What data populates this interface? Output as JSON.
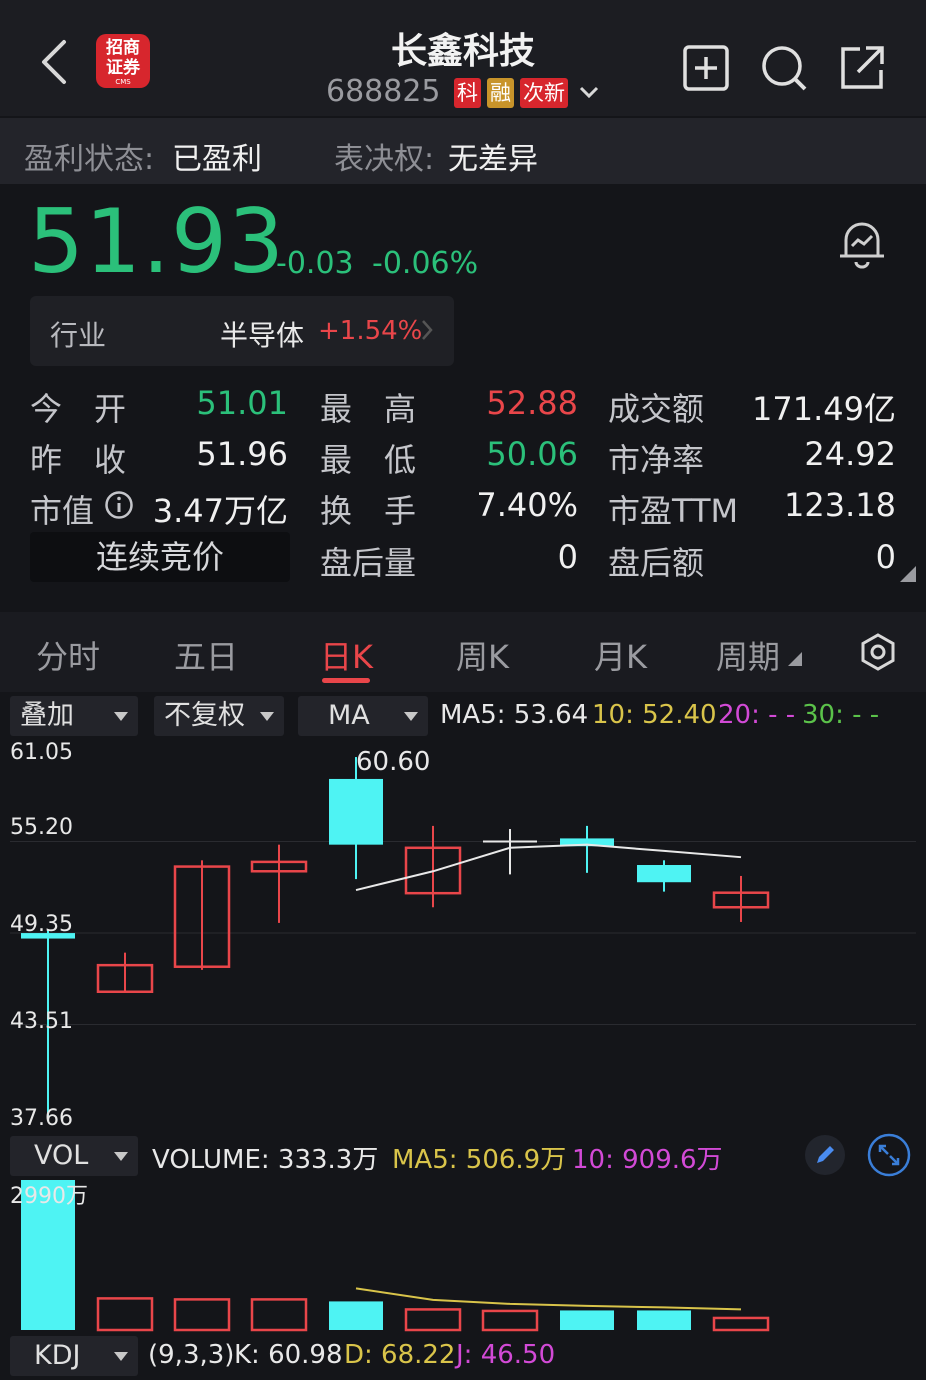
{
  "header": {
    "title": "长鑫科技",
    "code": "688825",
    "tags": [
      {
        "label": "科",
        "color": "#d7262d"
      },
      {
        "label": "融",
        "color": "#c8942a"
      },
      {
        "label": "次新",
        "color": "#d7262d"
      }
    ],
    "logo_line1": "招商",
    "logo_line2": "证券",
    "logo_small": "CMS",
    "icons": [
      "back-icon",
      "add-watchlist-icon",
      "search-icon",
      "share-icon"
    ]
  },
  "status": {
    "profit_label": "盈利状态:",
    "profit_value": "已盈利",
    "vote_label": "表决权:",
    "vote_value": "无差异"
  },
  "quote": {
    "price": "51.93",
    "change": "-0.03",
    "change_pct": "-0.06%",
    "industry_label": "行业",
    "industry_name": "半导体",
    "industry_change": "+1.54%",
    "rows": [
      [
        "今　开",
        "51.01",
        "最　高",
        "52.88",
        "成交额",
        "171.49亿"
      ],
      [
        "昨　收",
        "51.96",
        "最　低",
        "50.06",
        "市净率",
        "24.92"
      ],
      [
        "市值",
        "3.47万亿",
        "换　手",
        "7.40%",
        "市盈TTM",
        "123.18"
      ],
      [
        "",
        "",
        "盘后量",
        "0",
        "盘后额",
        "0"
      ]
    ],
    "auction_label": "连续竞价",
    "colors": {
      "up": "#e9464a",
      "down": "#2bc07a"
    }
  },
  "tabs": {
    "items": [
      "分时",
      "五日",
      "日K",
      "周K",
      "月K",
      "周期"
    ],
    "active": "日K"
  },
  "kline": {
    "overlay_select": "叠加",
    "adjust_select": "不复权",
    "indicator_select": "MA",
    "ma5": "MA5: 53.64",
    "ma10": "10: 52.40",
    "ma20": "20: - -",
    "ma30": "30: - -"
  },
  "vol": {
    "select": "VOL",
    "volume": "VOLUME: 333.3万",
    "ma5": "MA5: 506.9万",
    "ma10": "10: 909.6万",
    "axis_max": "2990万"
  },
  "kdj": {
    "select": "KDJ",
    "params": "(9,3,3)",
    "k": "K: 60.98",
    "d": "D: 68.22",
    "j": "J: 46.50"
  },
  "chart_data": {
    "type": "candlestick",
    "y_ticks": [
      "61.05",
      "55.20",
      "49.35",
      "43.51",
      "37.66"
    ],
    "ylim": [
      37.66,
      61.05
    ],
    "max_label": "60.60",
    "candles": [
      {
        "o": 49.35,
        "h": 49.6,
        "l": 37.66,
        "c": 49.0,
        "dir": "down"
      },
      {
        "o": 45.6,
        "h": 48.1,
        "l": 45.6,
        "c": 47.3,
        "dir": "up"
      },
      {
        "o": 47.2,
        "h": 54.0,
        "l": 47.0,
        "c": 53.6,
        "dir": "up"
      },
      {
        "o": 53.3,
        "h": 55.0,
        "l": 50.0,
        "c": 53.9,
        "dir": "up"
      },
      {
        "o": 59.2,
        "h": 60.6,
        "l": 52.8,
        "c": 55.0,
        "dir": "down"
      },
      {
        "o": 51.9,
        "h": 56.2,
        "l": 51.0,
        "c": 54.8,
        "dir": "up"
      },
      {
        "o": 55.2,
        "h": 56.0,
        "l": 53.1,
        "c": 55.2,
        "dir": "doji"
      },
      {
        "o": 55.4,
        "h": 56.2,
        "l": 53.2,
        "c": 54.9,
        "dir": "down"
      },
      {
        "o": 53.7,
        "h": 54.0,
        "l": 52.0,
        "c": 52.6,
        "dir": "down"
      },
      {
        "o": 51.0,
        "h": 53.0,
        "l": 50.06,
        "c": 51.93,
        "dir": "up"
      }
    ],
    "ma_line": [
      null,
      null,
      null,
      null,
      52.1,
      53.3,
      54.8,
      55.0,
      54.6,
      54.2
    ],
    "volumes": [
      {
        "v": 2990,
        "dir": "down"
      },
      {
        "v": 630,
        "dir": "up"
      },
      {
        "v": 610,
        "dir": "up"
      },
      {
        "v": 610,
        "dir": "up"
      },
      {
        "v": 570,
        "dir": "down"
      },
      {
        "v": 410,
        "dir": "up"
      },
      {
        "v": 380,
        "dir": "up"
      },
      {
        "v": 390,
        "dir": "down"
      },
      {
        "v": 390,
        "dir": "down"
      },
      {
        "v": 240,
        "dir": "up"
      }
    ],
    "vol_ma_line": [
      null,
      null,
      null,
      null,
      830,
      600,
      520,
      480,
      450,
      410
    ]
  }
}
